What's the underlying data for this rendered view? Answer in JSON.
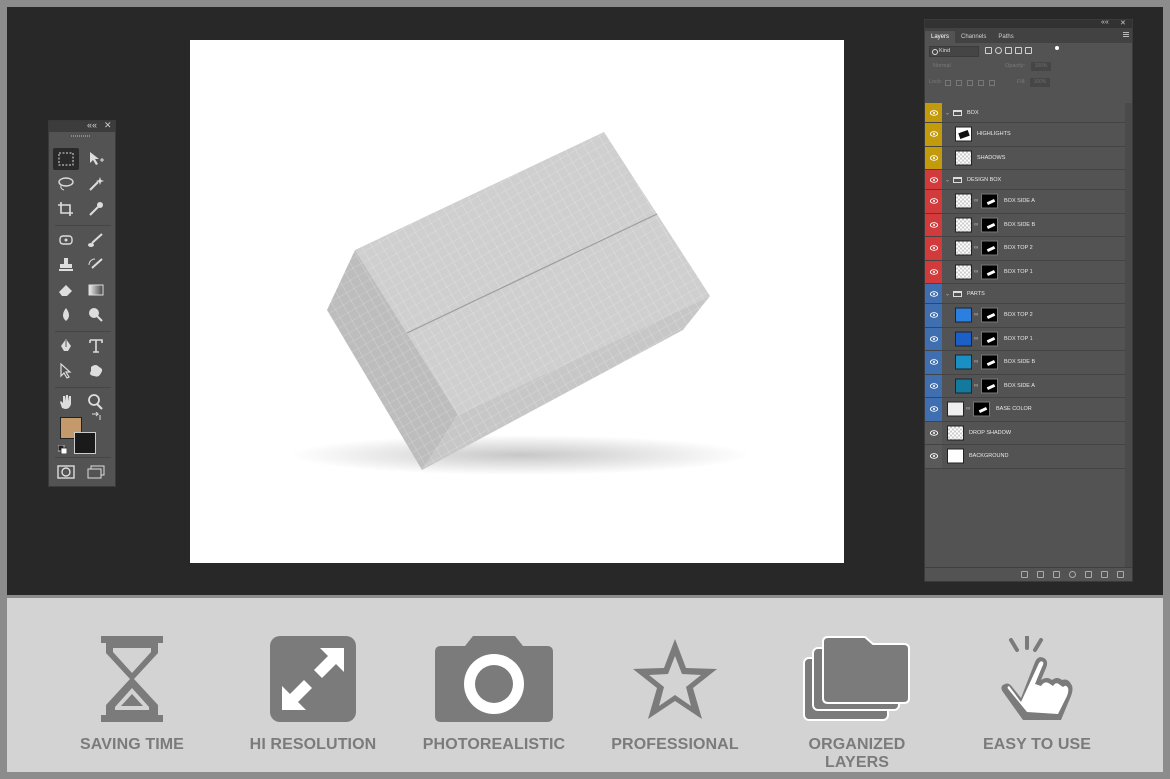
{
  "tools_panel": {
    "collapse_label": "««",
    "close_label": "✕",
    "tools": [
      {
        "name": "marquee-tool-icon"
      },
      {
        "name": "move-tool-icon"
      },
      {
        "name": "lasso-tool-icon"
      },
      {
        "name": "magic-wand-tool-icon"
      },
      {
        "name": "crop-tool-icon"
      },
      {
        "name": "eyedropper-tool-icon"
      },
      {
        "name": "spot-healing-tool-icon"
      },
      {
        "name": "brush-tool-icon"
      },
      {
        "name": "clone-stamp-tool-icon"
      },
      {
        "name": "history-brush-tool-icon"
      },
      {
        "name": "eraser-tool-icon"
      },
      {
        "name": "gradient-tool-icon"
      },
      {
        "name": "blur-tool-icon"
      },
      {
        "name": "dodge-tool-icon"
      },
      {
        "name": "pen-tool-icon"
      },
      {
        "name": "type-tool-icon"
      },
      {
        "name": "path-selection-tool-icon"
      },
      {
        "name": "custom-shape-tool-icon"
      },
      {
        "name": "hand-tool-icon"
      },
      {
        "name": "zoom-tool-icon"
      }
    ],
    "foreground_color": "#c49a6c",
    "background_color": "#1a1a1a"
  },
  "layers_panel": {
    "collapse_label": "««",
    "close_label": "✕",
    "tabs": [
      {
        "label": "Layers",
        "active": true
      },
      {
        "label": "Channels",
        "active": false
      },
      {
        "label": "Paths",
        "active": false
      }
    ],
    "filter_kind": "Kind",
    "blend_mode": "Normal",
    "opacity_label": "Opacity:",
    "opacity_value": "100%",
    "lock_label": "Lock:",
    "fill_label": "Fill:",
    "fill_value": "100%",
    "layers": [
      {
        "name": "BOX",
        "type": "group",
        "color": "#c39a0b",
        "depth": 0
      },
      {
        "name": "HIGHLIGHTS",
        "type": "smart",
        "color": "#c39a0b",
        "depth": 1
      },
      {
        "name": "SHADOWS",
        "type": "checker",
        "color": "#c39a0b",
        "depth": 1
      },
      {
        "name": "DESIGN BOX",
        "type": "group",
        "color": "#d23b3b",
        "depth": 0
      },
      {
        "name": "BOX SIDE A",
        "type": "masked",
        "color": "#d23b3b",
        "depth": 1
      },
      {
        "name": "BOX SIDE B",
        "type": "masked",
        "color": "#d23b3b",
        "depth": 1
      },
      {
        "name": "BOX TOP 2",
        "type": "masked",
        "color": "#d23b3b",
        "depth": 1
      },
      {
        "name": "BOX TOP 1",
        "type": "masked",
        "color": "#d23b3b",
        "depth": 1
      },
      {
        "name": "PARTS",
        "type": "group",
        "color": "#3f6fb0",
        "depth": 0
      },
      {
        "name": "BOX TOP 2",
        "type": "fill",
        "fill": "#2a7fe0",
        "color": "#3f6fb0",
        "depth": 1
      },
      {
        "name": "BOX TOP 1",
        "type": "fill",
        "fill": "#1c5fc7",
        "color": "#3f6fb0",
        "depth": 1
      },
      {
        "name": "BOX SIDE B",
        "type": "fill",
        "fill": "#1a8fc4",
        "color": "#3f6fb0",
        "depth": 1
      },
      {
        "name": "BOX SIDE A",
        "type": "fill",
        "fill": "#137a9e",
        "color": "#3f6fb0",
        "depth": 1
      },
      {
        "name": "BASE COLOR",
        "type": "fill",
        "fill": "#eeeeee",
        "color": "#3f6fb0",
        "depth": 0
      },
      {
        "name": "DROP SHADOW",
        "type": "checker",
        "color": "#5a5a5a",
        "depth": 0
      },
      {
        "name": "BACKGROUND",
        "type": "white",
        "color": "#5a5a5a",
        "depth": 0
      }
    ]
  },
  "features": [
    {
      "label": "SAVING TIME",
      "icon": "hourglass-icon"
    },
    {
      "label": "HI RESOLUTION",
      "icon": "expand-arrows-icon"
    },
    {
      "label": "PHOTOREALISTIC",
      "icon": "camera-icon"
    },
    {
      "label": "PROFESSIONAL",
      "icon": "star-icon"
    },
    {
      "label": "ORGANIZED LAYERS",
      "icon": "stacked-folders-icon"
    },
    {
      "label": "EASY TO USE",
      "icon": "pointing-hand-icon"
    }
  ],
  "colors": {
    "workspace": "#282828",
    "panel": "#535353",
    "band": "#d3d3d3",
    "feature_icon": "#7b7b7b"
  }
}
